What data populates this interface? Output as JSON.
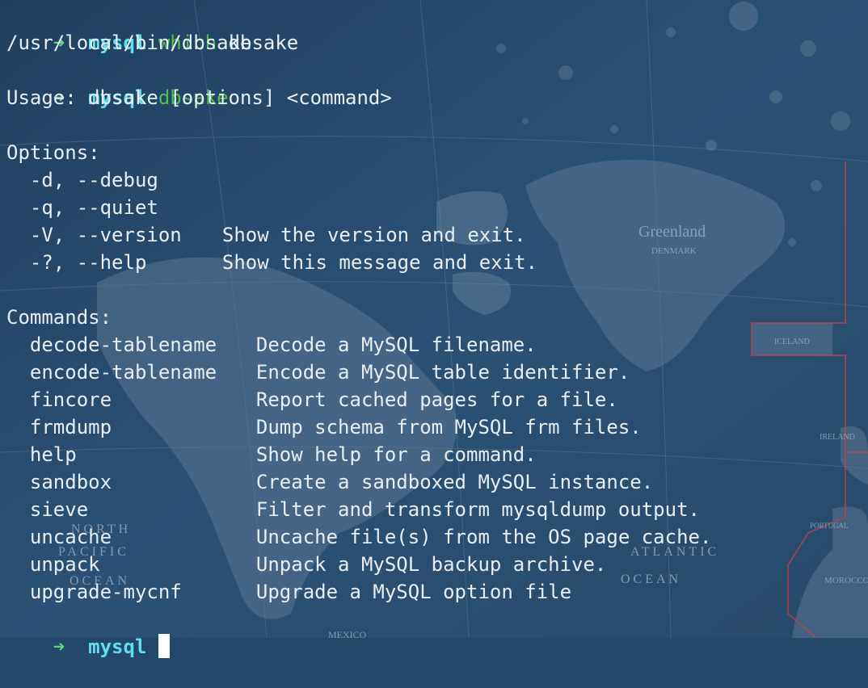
{
  "prompt_lines": [
    {
      "arrow": "➜",
      "dir": "mysql",
      "cmd": "which",
      "args": "dbsake"
    },
    {
      "arrow": "➜",
      "dir": "mysql",
      "cmd": "dbsake",
      "args": ""
    }
  ],
  "which_output": "/usr/local/bin/dbsake",
  "usage": "Usage: dbsake [options] <command>",
  "options_header": "Options:",
  "options": [
    {
      "flag": "-d, --debug",
      "desc": ""
    },
    {
      "flag": "-q, --quiet",
      "desc": ""
    },
    {
      "flag": "-V, --version",
      "desc": "Show the version and exit."
    },
    {
      "flag": "-?, --help",
      "desc": "Show this message and exit."
    }
  ],
  "commands_header": "Commands:",
  "commands": [
    {
      "name": "decode-tablename",
      "desc": "Decode a MySQL filename."
    },
    {
      "name": "encode-tablename",
      "desc": "Encode a MySQL table identifier."
    },
    {
      "name": "fincore",
      "desc": "Report cached pages for a file."
    },
    {
      "name": "frmdump",
      "desc": "Dump schema from MySQL frm files."
    },
    {
      "name": "help",
      "desc": "Show help for a command."
    },
    {
      "name": "sandbox",
      "desc": "Create a sandboxed MySQL instance."
    },
    {
      "name": "sieve",
      "desc": "Filter and transform mysqldump output."
    },
    {
      "name": "uncache",
      "desc": "Uncache file(s) from the OS page cache."
    },
    {
      "name": "unpack",
      "desc": "Unpack a MySQL backup archive."
    },
    {
      "name": "upgrade-mycnf",
      "desc": "Upgrade a MySQL option file"
    }
  ],
  "final_prompt": {
    "arrow": "➜",
    "dir": "mysql"
  },
  "background_map_labels": {
    "greenland": "Greenland",
    "denmark": "DENMARK",
    "iceland": "ICELAND",
    "ireland": "IRELAND",
    "north": "NORTH",
    "pacific": "PACIFIC",
    "ocean_left": "OCEAN",
    "atlantic": "ATLANTIC",
    "ocean_right": "OCEAN",
    "morocco": "MOROCCO",
    "portugal": "PORTUGAL",
    "mexico": "MEXICO"
  },
  "colors": {
    "background": "#24486a",
    "arrow": "#5fd38a",
    "directory": "#5fe0f0",
    "command": "#4fc04f",
    "text": "#e8eef4",
    "cursor": "#ffffff"
  }
}
